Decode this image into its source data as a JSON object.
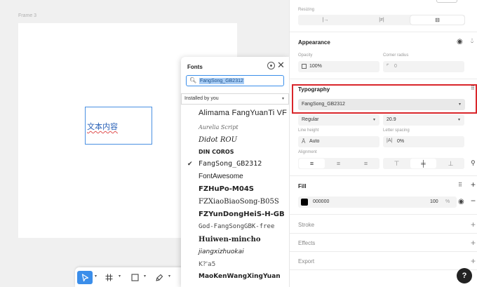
{
  "canvas": {
    "frame_label": "Frame 3",
    "text_content": "文本内容"
  },
  "toolbar": {
    "icons": [
      "cursor-icon",
      "frame-icon",
      "rectangle-icon",
      "pen-icon"
    ]
  },
  "fonts_popup": {
    "title": "Fonts",
    "search_value": "FangSong_GB2312",
    "filter": "Installed by you",
    "items": [
      "Alimama FangYuanTi VF",
      "Aurelia Script",
      "Didot ROU",
      "DIN COROS",
      "FangSong_GB2312",
      "FontAwesome",
      "FZHuPo-M04S",
      "FZXiaoBiaoSong-B05S",
      "FZYunDongHeiS-H-GB",
      "God-FangSongGBK-free",
      "Huiwen-mincho",
      "jiangxizhuokai",
      "K?'a5",
      "MaoKenWangXingYuan"
    ],
    "selected_index": 4
  },
  "panel": {
    "resizing_label": "Resizing",
    "resizing_options": [
      "|→",
      "|≠|",
      "⊟"
    ],
    "appearance": {
      "title": "Appearance",
      "opacity_label": "Opacity",
      "opacity_value": "100%",
      "radius_label": "Corner radius",
      "radius_value": "0"
    },
    "typography": {
      "title": "Typography",
      "font": "FangSong_GB2312",
      "weight": "Regular",
      "size": "20.9",
      "line_height_label": "Line height",
      "line_height_value": "Auto",
      "letter_spacing_label": "Letter spacing",
      "letter_spacing_value": "0%",
      "alignment_label": "Alignment"
    },
    "fill": {
      "title": "Fill",
      "hex": "000000",
      "opacity": "100",
      "unit": "%",
      "color": "#000000"
    },
    "stroke_title": "Stroke",
    "effects_title": "Effects",
    "export_title": "Export",
    "help": "?"
  },
  "colors": {
    "accent": "#3b8eea",
    "highlight_border": "#d9262b",
    "text_selection": "#a8cdf6"
  }
}
